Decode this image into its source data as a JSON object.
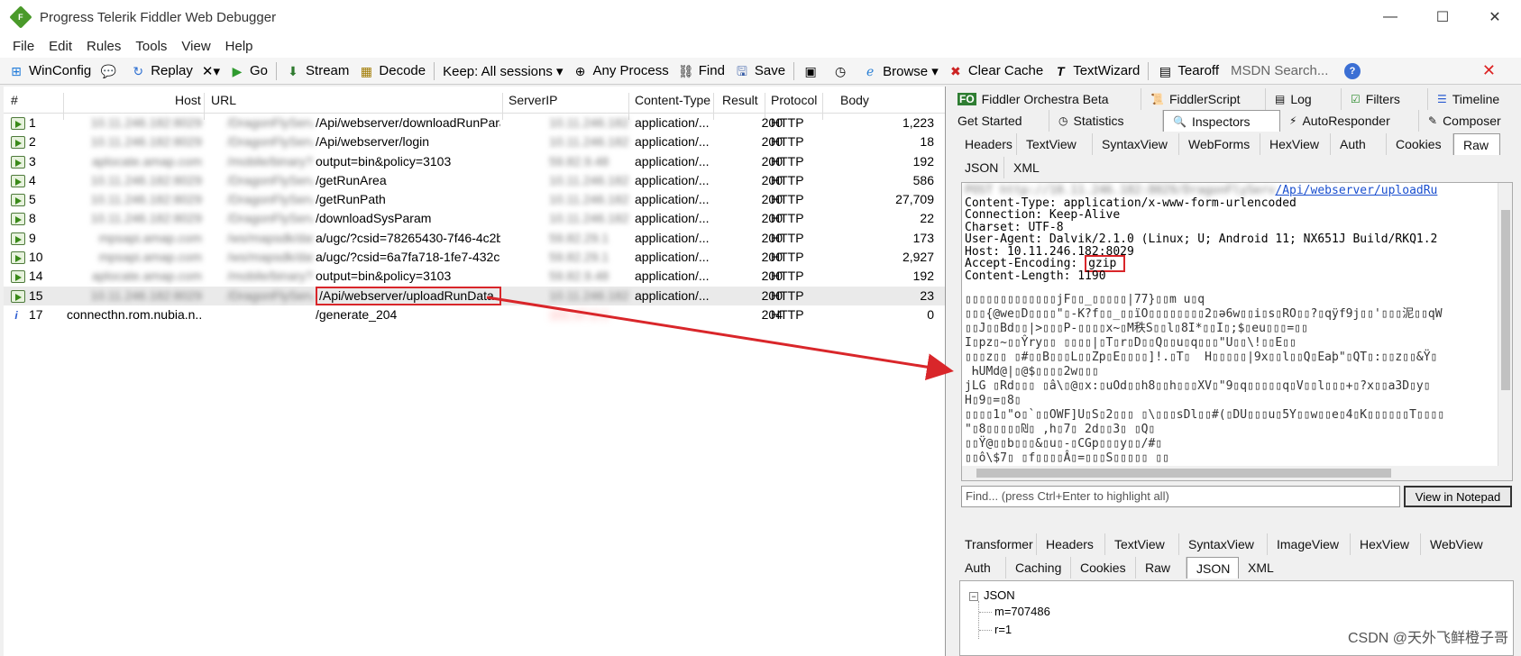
{
  "window": {
    "title": "Progress Telerik Fiddler Web Debugger",
    "controls": [
      "—",
      "☐",
      "✕"
    ]
  },
  "menu": [
    "File",
    "Edit",
    "Rules",
    "Tools",
    "View",
    "Help"
  ],
  "toolbar": {
    "winconfig": "WinConfig",
    "replay": "Replay",
    "remove_icon": "✕▾",
    "go": "Go",
    "stream": "Stream",
    "decode": "Decode",
    "keep": "Keep: All sessions ▾",
    "any_process": "Any Process",
    "find": "Find",
    "save": "Save",
    "browse": "Browse ▾",
    "clear_cache": "Clear Cache",
    "textwizard": "TextWizard",
    "tearoff": "Tearoff",
    "msdn_search": "MSDN Search..."
  },
  "sessions": {
    "headers": [
      "#",
      "Host",
      "URL",
      "ServerIP",
      "Content-Type",
      "Result",
      "Protocol",
      "Body"
    ],
    "rows": [
      {
        "id": "1",
        "host": "10.11.246.182:8029",
        "url_hidden": "/DragonFlyServ",
        "url": "/Api/webserver/downloadRunParam",
        "ip": "10.11.246.182",
        "ctype": "application/...",
        "result": "200",
        "protocol": "HTTP",
        "body": "1,223",
        "icon": "session"
      },
      {
        "id": "2",
        "host": "10.11.246.182:8029",
        "url_hidden": "/DragonFlyServ",
        "url": "/Api/webserver/login",
        "ip": "10.11.246.182",
        "ctype": "application/...",
        "result": "200",
        "protocol": "HTTP",
        "body": "18",
        "icon": "session"
      },
      {
        "id": "3",
        "host": "aplocate.amap.com",
        "url_hidden": "/mobile/binary?",
        "url": "output=bin&policy=3103",
        "ip": "59.82.9.48",
        "ctype": "application/...",
        "result": "200",
        "protocol": "HTTP",
        "body": "192",
        "icon": "session"
      },
      {
        "id": "4",
        "host": "10.11.246.182:8029",
        "url_hidden": "/DragonFlyServ",
        "url": "/getRunArea",
        "ip": "10.11.246.182",
        "ctype": "application/...",
        "result": "200",
        "protocol": "HTTP",
        "body": "586",
        "icon": "session"
      },
      {
        "id": "5",
        "host": "10.11.246.182:8029",
        "url_hidden": "/DragonFlyServ",
        "url": "/getRunPath",
        "ip": "10.11.246.182",
        "ctype": "application/...",
        "result": "200",
        "protocol": "HTTP",
        "body": "27,709",
        "icon": "session"
      },
      {
        "id": "8",
        "host": "10.11.246.182:8029",
        "url_hidden": "/DragonFlyServ",
        "url": "/downloadSysParam",
        "ip": "10.11.246.182",
        "ctype": "application/...",
        "result": "200",
        "protocol": "HTTP",
        "body": "22",
        "icon": "session"
      },
      {
        "id": "9",
        "host": "mpsapi.amap.com",
        "url_hidden": "/ws/mapsdk/dat",
        "url": "a/ugc/?csid=78265430-7f46-4c2b-9fe...",
        "ip": "59.82.29.1",
        "ctype": "application/...",
        "result": "200",
        "protocol": "HTTP",
        "body": "173",
        "icon": "session"
      },
      {
        "id": "10",
        "host": "mpsapi.amap.com",
        "url_hidden": "/ws/mapsdk/dat",
        "url": "a/ugc/?csid=6a7fa718-1fe7-432c-8fa...",
        "ip": "59.82.29.1",
        "ctype": "application/...",
        "result": "200",
        "protocol": "HTTP",
        "body": "2,927",
        "icon": "session"
      },
      {
        "id": "14",
        "host": "aplocate.amap.com",
        "url_hidden": "/mobile/binary?",
        "url": "output=bin&policy=3103",
        "ip": "59.82.9.48",
        "ctype": "application/...",
        "result": "200",
        "protocol": "HTTP",
        "body": "192",
        "icon": "session"
      },
      {
        "id": "15",
        "host": "10.11.246.182:8029",
        "url_hidden": "/DragonFlyServ",
        "url": "/Api/webserver/uploadRunData",
        "ip": "10.11.246.182",
        "ctype": "application/...",
        "result": "200",
        "protocol": "HTTP",
        "body": "23",
        "icon": "session",
        "selected": true
      },
      {
        "id": "17",
        "host": "connecthn.rom.nubia.n...",
        "url_hidden": "",
        "url": "/generate_204",
        "ip": "101.37.2.1",
        "ctype": "",
        "result": "204",
        "protocol": "HTTP",
        "body": "0",
        "icon": "info"
      }
    ]
  },
  "inspector": {
    "top_tabs_row1": [
      "Fiddler Orchestra Beta",
      "FiddlerScript",
      "Log",
      "Filters",
      "Timeline"
    ],
    "top_tabs_row2": [
      "Get Started",
      "Statistics",
      "Inspectors",
      "AutoResponder",
      "Composer"
    ],
    "request_tabs": [
      "Headers",
      "TextView",
      "SyntaxView",
      "WebForms",
      "HexView",
      "Auth",
      "Cookies",
      "Raw"
    ],
    "request_tabs2": [
      "JSON",
      "XML"
    ],
    "raw": {
      "first_line_hidden": "POST http://10.11.246.182:8029/DragonFlyServ",
      "first_line_link": "/Api/webserver/uploadRu",
      "headers": [
        "Content-Type: application/x-www-form-urlencoded",
        "Connection: Keep-Alive",
        "Charset: UTF-8",
        "User-Agent: Dalvik/2.1.0 (Linux; U; Android 11; NX651J Build/RKQ1.2",
        "Host: 10.11.246.182:8029",
        "Accept-Encoding: gzip",
        "Content-Length: 1190"
      ],
      "accept_encoding_label": "Accept-Encoding: ",
      "accept_encoding_value": "gzip",
      "binary_lines": [
        "▯▯▯▯▯▯▯▯▯▯▯▯▯jF▯▯_▯▯▯▯▯|77}▯▯m u▯q",
        "▯▯▯{@we▯D▯▯▯▯\"▯-K?f▯▯_▯▯ïO▯▯▯▯▯▯▯▯2▯ǝ6w▯▯i▯s▯RO▯▯?▯qÿf9j▯▯'▯▯▯泥▯▯qW",
        "▯▯J▯▯Bd▯▯|>▯▯▯P-▯▯▯▯x~▯M秩S▯▯l▯8I*▯▯I▯;$▯eu▯▯▯=▯▯",
        "I▯pz▯~▯▯Ŷry▯▯ ▯▯▯▯|▯T▯r▯D▯▯Q▯▯u▯q▯▯▯\"U▯▯\\!▯▯E▯▯",
        "▯▯▯z▯▯ ▯#▯▯B▯▯▯L▯▯Zp▯E▯▯▯▯]!.▯T▯  H▯▯▯▯▯|9x▯▯l▯▯Q▯Eaþ\"▯QT▯:▯▯z▯▯&Ÿ▯",
        " ҺUMd@|▯@$▯▯▯▯2w▯▯▯",
        "jLG ▯Rd▯▯▯ ▯â\\▯@▯x:▯uOd▯▯h8▯▯h▯▯▯XV▯\"9▯q▯▯▯▯▯q▯V▯▯l▯▯▯+▯?x▯▯a3D▯y▯",
        "H▯9▯=▯8▯",
        "▯▯▯▯1▯\"o▯`▯▯OWF]U▯S▯2▯▯▯ ▯\\▯▯▯sDl▯▯#(▯DU▯▯▯u▯5Y▯▯w▯▯e▯4▯K▯▯▯▯▯▯T▯▯▯▯",
        "\"▯8▯▯▯▯▯₪▯ ,h▯7▯ 2d▯▯3▯ ▯Q▯",
        "▯▯Ÿ@▯▯b▯▯▯&▯u▯-▯CGp▯▯▯y▯▯/#▯",
        "▯▯ô\\$7▯ ▯f▯▯▯▯Â▯=▯▯▯S▯▯▯▯▯ ▯▯"
      ]
    },
    "find_placeholder": "Find... (press Ctrl+Enter to highlight all)",
    "view_in_notepad": "View in Notepad",
    "response_tabs": [
      "Transformer",
      "Headers",
      "TextView",
      "SyntaxView",
      "ImageView",
      "HexView",
      "WebView"
    ],
    "response_tabs2": [
      "Auth",
      "Caching",
      "Cookies",
      "Raw",
      "JSON",
      "XML"
    ],
    "json_tree": {
      "root": "JSON",
      "items": [
        "m=707486",
        "r=1"
      ]
    }
  },
  "watermark": "CSDN @天外飞鲜橙子哥",
  "colors": {
    "highlight": "#d9262a",
    "link": "#1a4fcf"
  }
}
